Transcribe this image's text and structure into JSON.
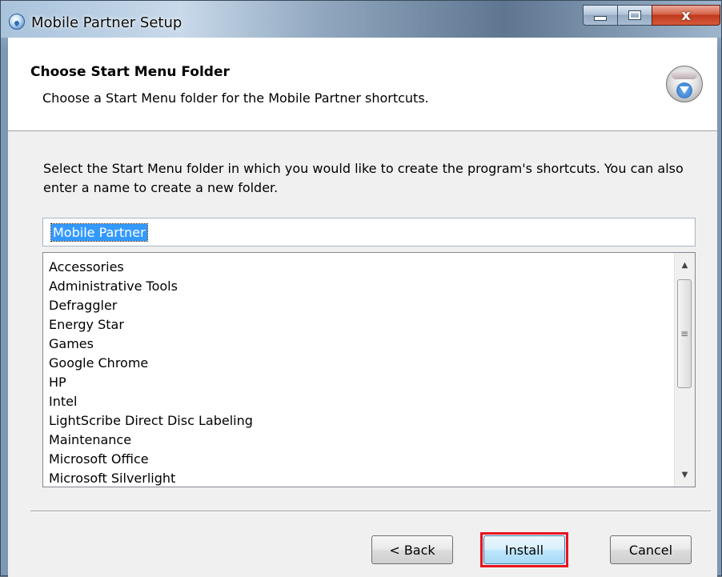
{
  "window": {
    "title": "Mobile Partner Setup",
    "controls": {
      "minimize": "minimize",
      "maximize": "maximize",
      "close": "x"
    }
  },
  "header": {
    "title": "Choose Start Menu Folder",
    "subtitle": "Choose a Start Menu folder for the Mobile Partner shortcuts."
  },
  "main": {
    "description": "Select the Start Menu folder in which you would like to create the program's shortcuts. You can also enter a name to create a new folder.",
    "folder_input_value": "Mobile Partner",
    "folders": [
      "Accessories",
      "Administrative Tools",
      "Defraggler",
      "Energy Star",
      "Games",
      "Google Chrome",
      "HP",
      "Intel",
      "LightScribe Direct Disc Labeling",
      "Maintenance",
      "Microsoft Office",
      "Microsoft Silverlight"
    ]
  },
  "buttons": {
    "back": "< Back",
    "install": "Install",
    "cancel": "Cancel"
  },
  "colors": {
    "highlight": "#e8141e",
    "selection": "#3399ff"
  }
}
